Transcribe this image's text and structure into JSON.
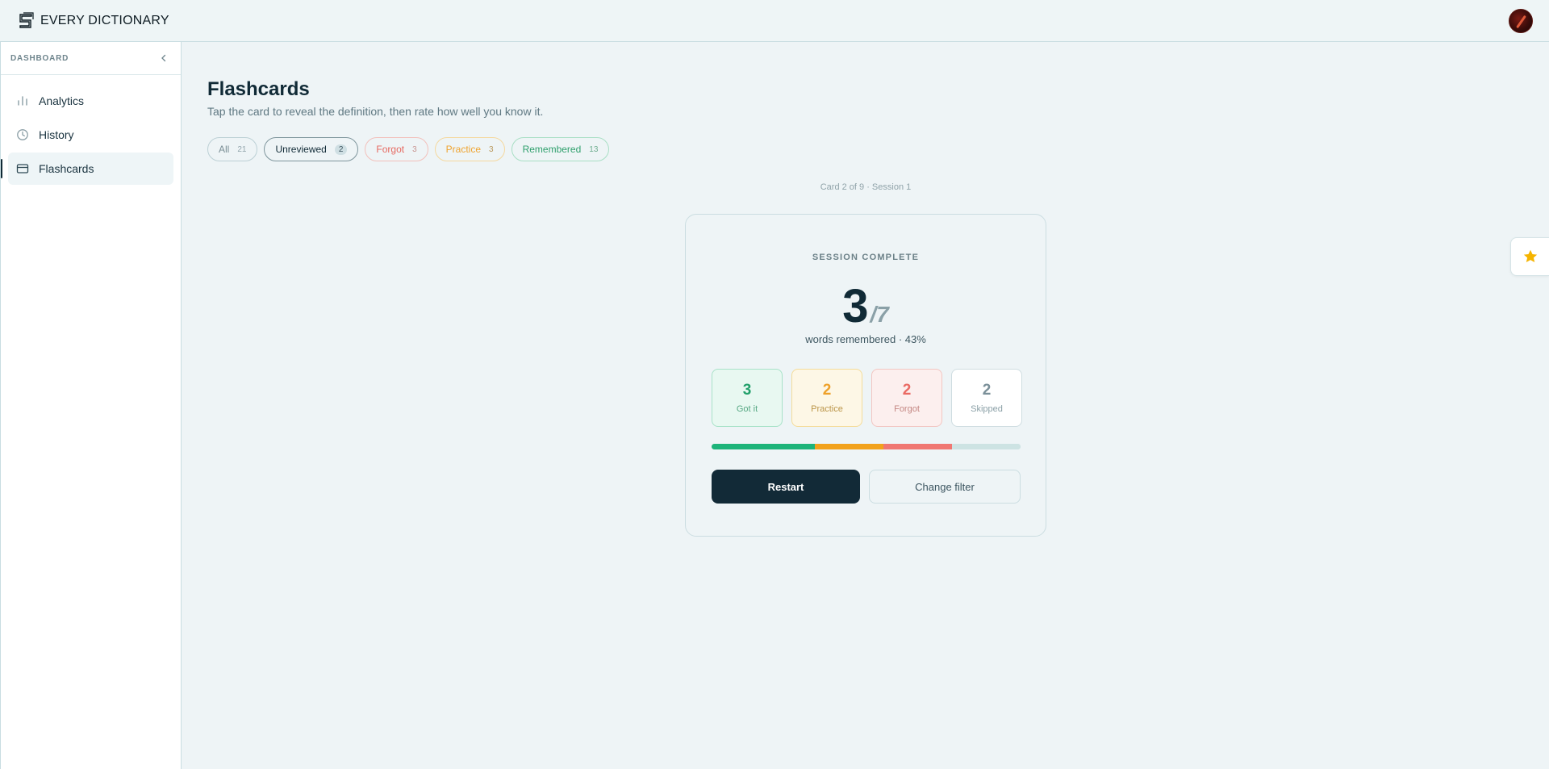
{
  "app": {
    "brand": "EVERY DICTIONARY"
  },
  "sidebar": {
    "header": "DASHBOARD",
    "items": [
      {
        "label": "Analytics",
        "icon": "bar-chart-icon"
      },
      {
        "label": "History",
        "icon": "clock-icon"
      },
      {
        "label": "Flashcards",
        "icon": "card-icon",
        "active": true
      }
    ]
  },
  "page": {
    "title": "Flashcards",
    "subtitle": "Tap the card to reveal the definition, then rate how well you know it."
  },
  "filters": [
    {
      "label": "All",
      "count": "21"
    },
    {
      "label": "Unreviewed",
      "count": "2",
      "selected": true
    },
    {
      "label": "Forgot",
      "count": "3"
    },
    {
      "label": "Practice",
      "count": "3"
    },
    {
      "label": "Remembered",
      "count": "13"
    }
  ],
  "card_meta": "Card 2 of 9 · Session 1",
  "summary": {
    "heading": "SESSION COMPLETE",
    "score": "3",
    "total": "/7",
    "subtitle": "words remembered · 43%",
    "stats": [
      {
        "value": "3",
        "label": "Got it"
      },
      {
        "value": "2",
        "label": "Practice"
      },
      {
        "value": "2",
        "label": "Forgot"
      },
      {
        "value": "2",
        "label": "Skipped"
      }
    ],
    "progress": [
      {
        "key": "got",
        "fraction": 0.333,
        "color": "#1db47a"
      },
      {
        "key": "practice",
        "fraction": 0.222,
        "color": "#f2a21c"
      },
      {
        "key": "forgot",
        "fraction": 0.222,
        "color": "#f07772"
      },
      {
        "key": "skipped",
        "fraction": 0.223,
        "color": "#cde3e3"
      }
    ],
    "restart_label": "Restart",
    "change_filter_label": "Change filter"
  },
  "colors": {
    "accent_dark": "#122a37",
    "got": "#22a06b",
    "practice": "#eea12a",
    "forgot": "#ea6a63",
    "star": "#f5b400"
  }
}
